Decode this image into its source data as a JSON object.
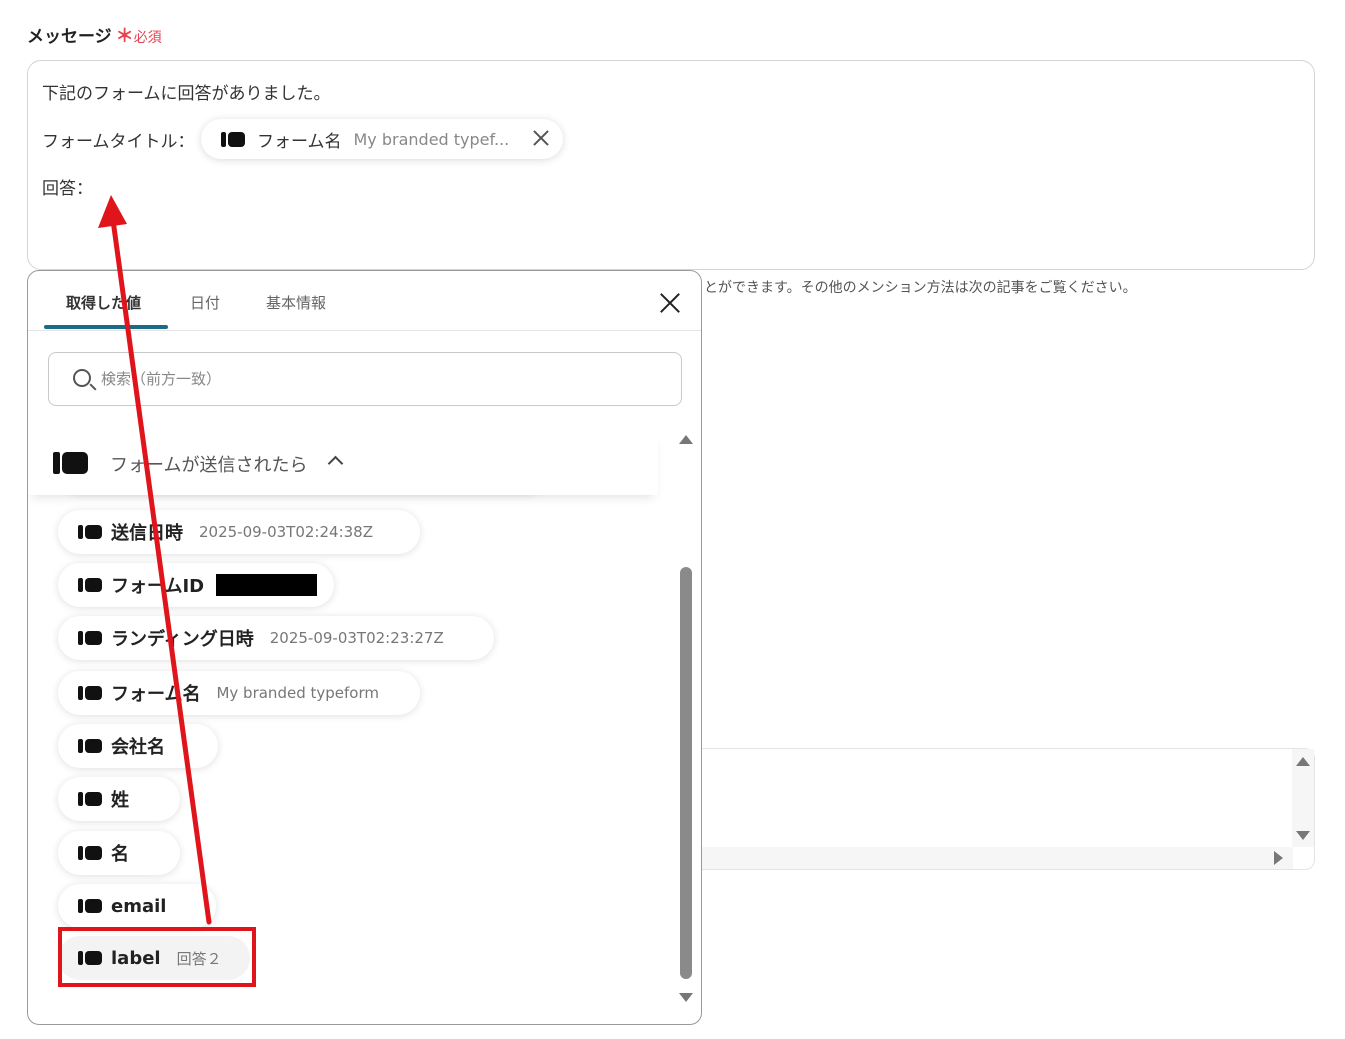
{
  "field": {
    "label": "メッセージ",
    "required_star": "＊",
    "required_text": "必須"
  },
  "message": {
    "line1": "下記のフォームに回答がありました。",
    "line2_prefix": "フォームタイトル：",
    "line3_prefix": "回答："
  },
  "title_chip": {
    "icon": "typeform-logo-icon",
    "name": "フォーム名",
    "value": "My branded typef..."
  },
  "helper_text": "とができます。その他のメンション方法は次の記事をご覧ください。",
  "popover": {
    "tabs": [
      {
        "label": "取得した値",
        "active": true
      },
      {
        "label": "日付",
        "active": false
      },
      {
        "label": "基本情報",
        "active": false
      }
    ],
    "search_placeholder": "検索（前方一致）",
    "group": {
      "icon": "typeform-logo-icon",
      "title": "フォームが送信されたら",
      "expanded": true
    },
    "items": [
      {
        "name": "送信日時",
        "value": "2025-09-03T02:24:38Z"
      },
      {
        "name": "フォームID",
        "value": "",
        "redacted": true
      },
      {
        "name": "ランディング日時",
        "value": "2025-09-03T02:23:27Z"
      },
      {
        "name": "フォーム名",
        "value": "My branded typeform"
      },
      {
        "name": "会社名",
        "value": ""
      },
      {
        "name": "姓",
        "value": ""
      },
      {
        "name": "名",
        "value": ""
      },
      {
        "name": "email",
        "value": ""
      },
      {
        "name": "label",
        "value": "回答２",
        "highlighted": true
      }
    ]
  },
  "colors": {
    "accent_tab": "#1c6b86",
    "required": "#e4434f",
    "annotation_red": "#e0151b"
  }
}
